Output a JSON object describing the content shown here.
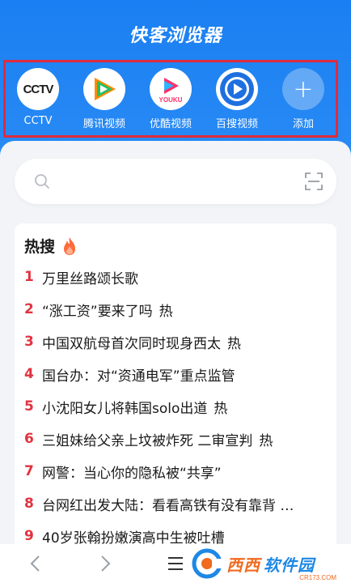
{
  "app": {
    "title": "快客浏览器"
  },
  "shortcuts": [
    {
      "label": "CCTV",
      "icon": "cctv-logo-icon",
      "logo_text": "CCTV"
    },
    {
      "label": "腾讯视频",
      "icon": "tencent-video-icon"
    },
    {
      "label": "优酷视频",
      "icon": "youku-icon",
      "logo_text": "YOUKU"
    },
    {
      "label": "百搜视频",
      "icon": "baisou-video-icon"
    },
    {
      "label": "添加",
      "icon": "plus-icon",
      "glyph": "+"
    }
  ],
  "search": {
    "placeholder": "",
    "value": ""
  },
  "hot": {
    "title": "热搜",
    "items": [
      {
        "rank": "1",
        "text": "万里丝路颂长歌",
        "tag": ""
      },
      {
        "rank": "2",
        "text": "“涨工资”要来了吗",
        "tag": "热"
      },
      {
        "rank": "3",
        "text": "中国双航母首次同时现身西太",
        "tag": "热"
      },
      {
        "rank": "4",
        "text": "国台办：对“资通电军”重点监管",
        "tag": ""
      },
      {
        "rank": "5",
        "text": "小沈阳女儿将韩国solo出道",
        "tag": "热"
      },
      {
        "rank": "6",
        "text": "三姐妹给父亲上坟被炸死 二审宣判",
        "tag": "热"
      },
      {
        "rank": "7",
        "text": "网警：当心你的隐私被“共享”",
        "tag": ""
      },
      {
        "rank": "8",
        "text": "台网红出发大陆：看看高铁有没有靠背 …",
        "tag": ""
      },
      {
        "rank": "9",
        "text": "40岁张翰扮嫩演高中生被吐槽",
        "tag": ""
      }
    ]
  },
  "watermark": {
    "text_a": "西西",
    "text_b": "软件园",
    "sub": "CR173.COM"
  },
  "colors": {
    "header_blue": "#1f82f0",
    "rank_red": "#e2323f",
    "highlight_border": "#e02b3c"
  }
}
